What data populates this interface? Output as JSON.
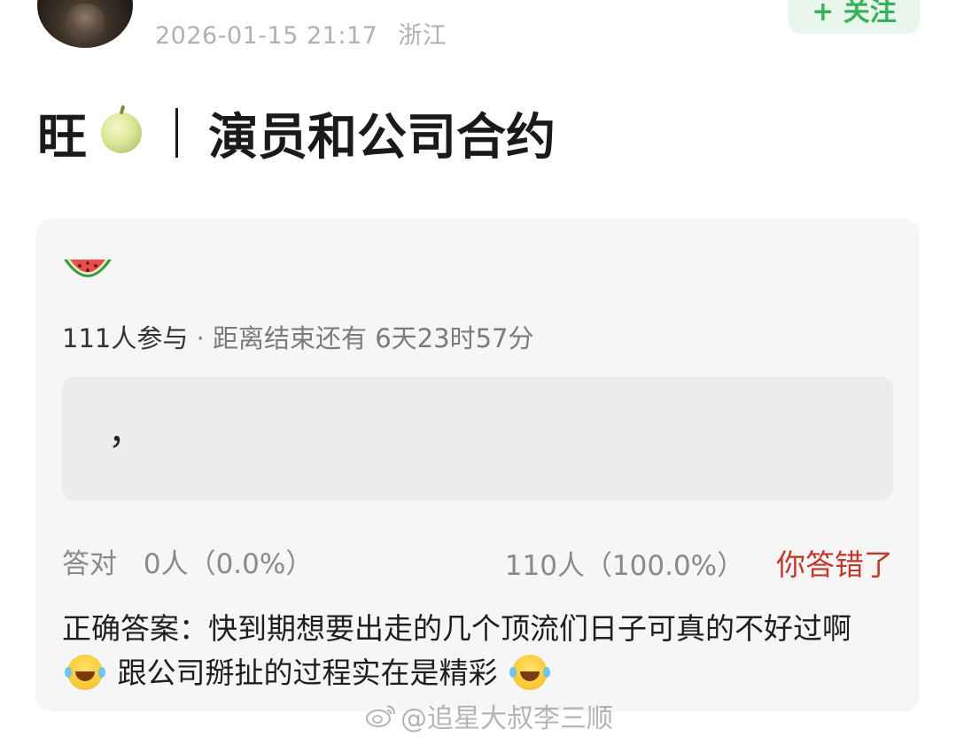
{
  "post": {
    "timestamp": "2026-01-15 21:17",
    "location": "浙江",
    "follow_label": "+ 关注",
    "title_lead": "旺",
    "title_main": "演员和公司合约"
  },
  "quiz": {
    "participants": "111人参与",
    "dot": "·",
    "remaining": "距离结束还有 6天23时57分",
    "answer": "，",
    "correct_label": "答对",
    "correct_count": "0人（0.0%）",
    "other_count": "110人（100.0%）",
    "wrong_label": "你答错了",
    "answer_prefix": "正确答案：",
    "answer_part1": "快到期想要出走的几个顶流们日子可真的不好过啊",
    "answer_part2": "跟公司掰扯的过程实在是精彩"
  },
  "watermark": {
    "text": "@追星大叔李三顺"
  },
  "colors": {
    "follow": "#37b15a",
    "wrong": "#c0392b"
  },
  "icons": [
    "avatar",
    "melon-icon",
    "watermelon-icon",
    "laughing-emoji-icon",
    "weibo-icon"
  ]
}
